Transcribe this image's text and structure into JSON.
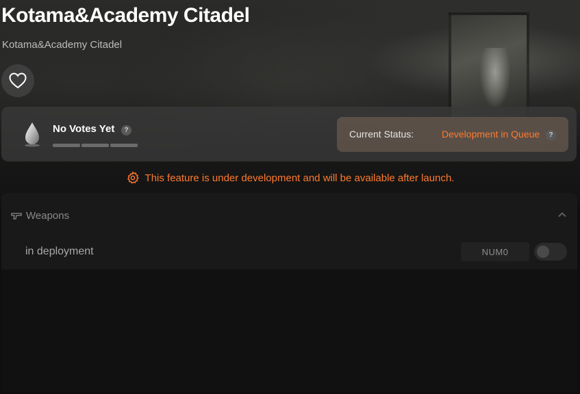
{
  "header": {
    "title": "Kotama&Academy Citadel",
    "subtitle": "Kotama&Academy Citadel"
  },
  "votes": {
    "label": "No Votes Yet",
    "help": "?",
    "bars_filled": 0,
    "bars_total": 3
  },
  "status": {
    "label": "Current Status:",
    "value": "Development in Queue",
    "help": "?",
    "accent_color": "#ff7a2e"
  },
  "notice": {
    "text": "This feature is under development and will be available after launch.",
    "icon": "gear-warning-icon"
  },
  "weapons": {
    "header": "Weapons",
    "icon": "gun-icon",
    "row": {
      "label": "in deployment",
      "badge": "NUM0",
      "toggle_on": false
    }
  },
  "icons": {
    "favorite": "heart-icon",
    "votes": "droplet-icon",
    "collapse": "chevron-up-icon"
  }
}
